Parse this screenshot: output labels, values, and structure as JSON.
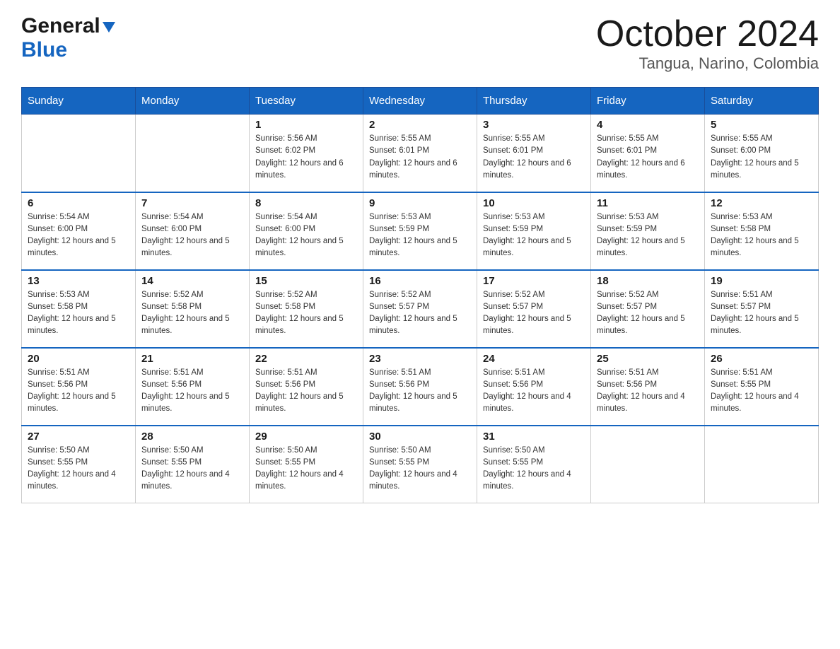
{
  "header": {
    "logo_general": "General",
    "logo_blue": "Blue",
    "month_title": "October 2024",
    "location": "Tangua, Narino, Colombia"
  },
  "weekdays": [
    "Sunday",
    "Monday",
    "Tuesday",
    "Wednesday",
    "Thursday",
    "Friday",
    "Saturday"
  ],
  "weeks": [
    [
      {
        "day": "",
        "sunrise": "",
        "sunset": "",
        "daylight": ""
      },
      {
        "day": "",
        "sunrise": "",
        "sunset": "",
        "daylight": ""
      },
      {
        "day": "1",
        "sunrise": "Sunrise: 5:56 AM",
        "sunset": "Sunset: 6:02 PM",
        "daylight": "Daylight: 12 hours and 6 minutes."
      },
      {
        "day": "2",
        "sunrise": "Sunrise: 5:55 AM",
        "sunset": "Sunset: 6:01 PM",
        "daylight": "Daylight: 12 hours and 6 minutes."
      },
      {
        "day": "3",
        "sunrise": "Sunrise: 5:55 AM",
        "sunset": "Sunset: 6:01 PM",
        "daylight": "Daylight: 12 hours and 6 minutes."
      },
      {
        "day": "4",
        "sunrise": "Sunrise: 5:55 AM",
        "sunset": "Sunset: 6:01 PM",
        "daylight": "Daylight: 12 hours and 6 minutes."
      },
      {
        "day": "5",
        "sunrise": "Sunrise: 5:55 AM",
        "sunset": "Sunset: 6:00 PM",
        "daylight": "Daylight: 12 hours and 5 minutes."
      }
    ],
    [
      {
        "day": "6",
        "sunrise": "Sunrise: 5:54 AM",
        "sunset": "Sunset: 6:00 PM",
        "daylight": "Daylight: 12 hours and 5 minutes."
      },
      {
        "day": "7",
        "sunrise": "Sunrise: 5:54 AM",
        "sunset": "Sunset: 6:00 PM",
        "daylight": "Daylight: 12 hours and 5 minutes."
      },
      {
        "day": "8",
        "sunrise": "Sunrise: 5:54 AM",
        "sunset": "Sunset: 6:00 PM",
        "daylight": "Daylight: 12 hours and 5 minutes."
      },
      {
        "day": "9",
        "sunrise": "Sunrise: 5:53 AM",
        "sunset": "Sunset: 5:59 PM",
        "daylight": "Daylight: 12 hours and 5 minutes."
      },
      {
        "day": "10",
        "sunrise": "Sunrise: 5:53 AM",
        "sunset": "Sunset: 5:59 PM",
        "daylight": "Daylight: 12 hours and 5 minutes."
      },
      {
        "day": "11",
        "sunrise": "Sunrise: 5:53 AM",
        "sunset": "Sunset: 5:59 PM",
        "daylight": "Daylight: 12 hours and 5 minutes."
      },
      {
        "day": "12",
        "sunrise": "Sunrise: 5:53 AM",
        "sunset": "Sunset: 5:58 PM",
        "daylight": "Daylight: 12 hours and 5 minutes."
      }
    ],
    [
      {
        "day": "13",
        "sunrise": "Sunrise: 5:53 AM",
        "sunset": "Sunset: 5:58 PM",
        "daylight": "Daylight: 12 hours and 5 minutes."
      },
      {
        "day": "14",
        "sunrise": "Sunrise: 5:52 AM",
        "sunset": "Sunset: 5:58 PM",
        "daylight": "Daylight: 12 hours and 5 minutes."
      },
      {
        "day": "15",
        "sunrise": "Sunrise: 5:52 AM",
        "sunset": "Sunset: 5:58 PM",
        "daylight": "Daylight: 12 hours and 5 minutes."
      },
      {
        "day": "16",
        "sunrise": "Sunrise: 5:52 AM",
        "sunset": "Sunset: 5:57 PM",
        "daylight": "Daylight: 12 hours and 5 minutes."
      },
      {
        "day": "17",
        "sunrise": "Sunrise: 5:52 AM",
        "sunset": "Sunset: 5:57 PM",
        "daylight": "Daylight: 12 hours and 5 minutes."
      },
      {
        "day": "18",
        "sunrise": "Sunrise: 5:52 AM",
        "sunset": "Sunset: 5:57 PM",
        "daylight": "Daylight: 12 hours and 5 minutes."
      },
      {
        "day": "19",
        "sunrise": "Sunrise: 5:51 AM",
        "sunset": "Sunset: 5:57 PM",
        "daylight": "Daylight: 12 hours and 5 minutes."
      }
    ],
    [
      {
        "day": "20",
        "sunrise": "Sunrise: 5:51 AM",
        "sunset": "Sunset: 5:56 PM",
        "daylight": "Daylight: 12 hours and 5 minutes."
      },
      {
        "day": "21",
        "sunrise": "Sunrise: 5:51 AM",
        "sunset": "Sunset: 5:56 PM",
        "daylight": "Daylight: 12 hours and 5 minutes."
      },
      {
        "day": "22",
        "sunrise": "Sunrise: 5:51 AM",
        "sunset": "Sunset: 5:56 PM",
        "daylight": "Daylight: 12 hours and 5 minutes."
      },
      {
        "day": "23",
        "sunrise": "Sunrise: 5:51 AM",
        "sunset": "Sunset: 5:56 PM",
        "daylight": "Daylight: 12 hours and 5 minutes."
      },
      {
        "day": "24",
        "sunrise": "Sunrise: 5:51 AM",
        "sunset": "Sunset: 5:56 PM",
        "daylight": "Daylight: 12 hours and 4 minutes."
      },
      {
        "day": "25",
        "sunrise": "Sunrise: 5:51 AM",
        "sunset": "Sunset: 5:56 PM",
        "daylight": "Daylight: 12 hours and 4 minutes."
      },
      {
        "day": "26",
        "sunrise": "Sunrise: 5:51 AM",
        "sunset": "Sunset: 5:55 PM",
        "daylight": "Daylight: 12 hours and 4 minutes."
      }
    ],
    [
      {
        "day": "27",
        "sunrise": "Sunrise: 5:50 AM",
        "sunset": "Sunset: 5:55 PM",
        "daylight": "Daylight: 12 hours and 4 minutes."
      },
      {
        "day": "28",
        "sunrise": "Sunrise: 5:50 AM",
        "sunset": "Sunset: 5:55 PM",
        "daylight": "Daylight: 12 hours and 4 minutes."
      },
      {
        "day": "29",
        "sunrise": "Sunrise: 5:50 AM",
        "sunset": "Sunset: 5:55 PM",
        "daylight": "Daylight: 12 hours and 4 minutes."
      },
      {
        "day": "30",
        "sunrise": "Sunrise: 5:50 AM",
        "sunset": "Sunset: 5:55 PM",
        "daylight": "Daylight: 12 hours and 4 minutes."
      },
      {
        "day": "31",
        "sunrise": "Sunrise: 5:50 AM",
        "sunset": "Sunset: 5:55 PM",
        "daylight": "Daylight: 12 hours and 4 minutes."
      },
      {
        "day": "",
        "sunrise": "",
        "sunset": "",
        "daylight": ""
      },
      {
        "day": "",
        "sunrise": "",
        "sunset": "",
        "daylight": ""
      }
    ]
  ]
}
